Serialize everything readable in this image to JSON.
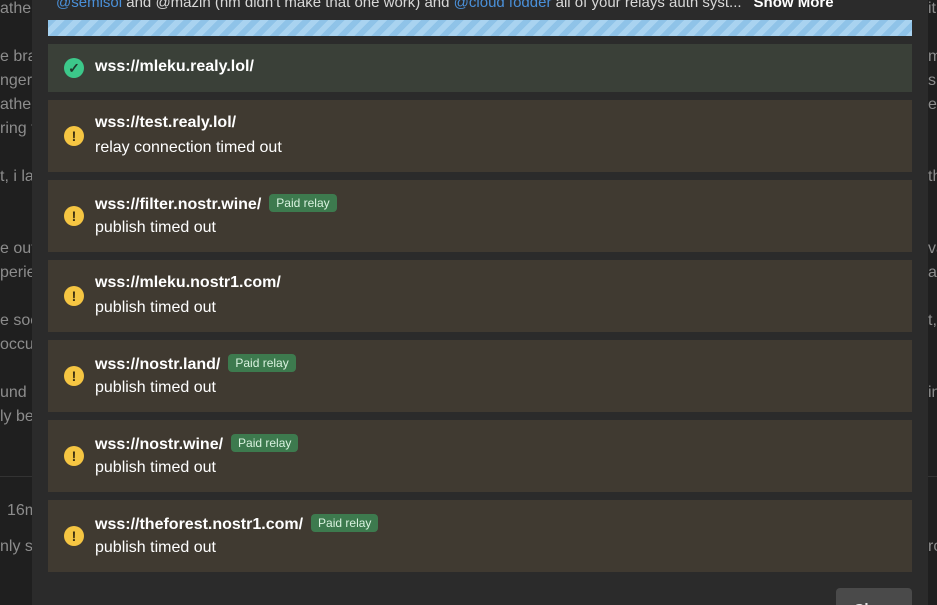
{
  "background": {
    "left_fragments": [
      "ather",
      "e brai",
      "nger",
      "ather",
      "ring t",
      "t, i la",
      "e out",
      "perie",
      "e soc",
      "occu",
      "und",
      "ly be",
      "16m",
      "nly st"
    ],
    "right_fragments": [
      "it",
      "m",
      "s",
      "e",
      "th",
      "va",
      "a",
      "t,",
      "in",
      "ro"
    ]
  },
  "modal": {
    "top_text": {
      "mention1": "@semisol",
      "text1": " and @mazin (hm didn't make that one work) and ",
      "mention2": "@cloud fodder",
      "text2": " all of your relays auth syst...",
      "show_more": "Show More"
    },
    "relays": [
      {
        "url": "wss://mleku.realy.lol/",
        "status": "",
        "paid": false,
        "state": "ok"
      },
      {
        "url": "wss://test.realy.lol/",
        "status": "relay connection timed out",
        "paid": false,
        "state": "warn"
      },
      {
        "url": "wss://filter.nostr.wine/",
        "status": "publish timed out",
        "paid": true,
        "state": "warn"
      },
      {
        "url": "wss://mleku.nostr1.com/",
        "status": "publish timed out",
        "paid": false,
        "state": "warn"
      },
      {
        "url": "wss://nostr.land/",
        "status": "publish timed out",
        "paid": true,
        "state": "warn"
      },
      {
        "url": "wss://nostr.wine/",
        "status": "publish timed out",
        "paid": true,
        "state": "warn"
      },
      {
        "url": "wss://theforest.nostr1.com/",
        "status": "publish timed out",
        "paid": true,
        "state": "warn"
      }
    ],
    "paid_label": "Paid relay",
    "ok_icon_glyph": "✓",
    "warn_icon_glyph": "!",
    "close_label": "Close"
  },
  "icons": {
    "ok": "check-circle-icon",
    "warn": "alert-circle-icon"
  },
  "colors": {
    "ok": "#3cc88a",
    "warn": "#f5c542",
    "paid_badge": "#3d7a4e",
    "mention": "#4a90d9"
  }
}
